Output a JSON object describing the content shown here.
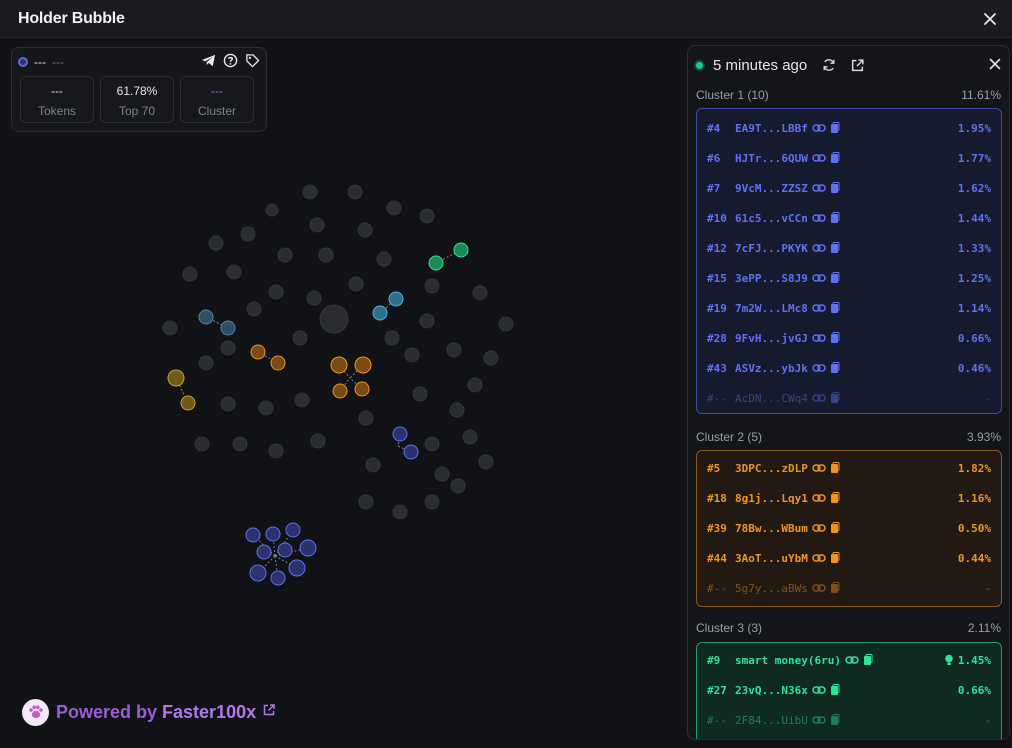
{
  "window": {
    "title": "Holder Bubble"
  },
  "token": {
    "name": "---",
    "symbol": "---"
  },
  "stats": [
    {
      "value": "---",
      "label": "Tokens"
    },
    {
      "value": "61.78%",
      "label": "Top 70"
    },
    {
      "value": "---",
      "label": "Cluster"
    }
  ],
  "powered": {
    "prefix": "Powered by",
    "brand": "Faster100x"
  },
  "panel": {
    "updated": "5 minutes ago",
    "clusters": [
      {
        "title": "Cluster 1 (10)",
        "total": "11.61%",
        "color": "#5d72ef",
        "rows": [
          {
            "rank": "#4",
            "address": "EA9T...LBBf",
            "percent": "1.95%"
          },
          {
            "rank": "#6",
            "address": "HJTr...6QUW",
            "percent": "1.77%"
          },
          {
            "rank": "#7",
            "address": "9VcM...ZZSZ",
            "percent": "1.62%"
          },
          {
            "rank": "#10",
            "address": "61c5...vCCn",
            "percent": "1.44%"
          },
          {
            "rank": "#12",
            "address": "7cFJ...PKYK",
            "percent": "1.33%"
          },
          {
            "rank": "#15",
            "address": "3ePP...S8J9",
            "percent": "1.25%"
          },
          {
            "rank": "#19",
            "address": "7m2W...LMc8",
            "percent": "1.14%"
          },
          {
            "rank": "#28",
            "address": "9FvH...jvGJ",
            "percent": "0.66%"
          },
          {
            "rank": "#43",
            "address": "ASVz...ybJk",
            "percent": "0.46%"
          },
          {
            "rank": "#--",
            "address": "AcDN...CWq4",
            "percent": "-"
          }
        ]
      },
      {
        "title": "Cluster 2 (5)",
        "total": "3.93%",
        "color": "#ee9424",
        "rows": [
          {
            "rank": "#5",
            "address": "3DPC...zDLP",
            "percent": "1.82%"
          },
          {
            "rank": "#18",
            "address": "8g1j...Lqy1",
            "percent": "1.16%"
          },
          {
            "rank": "#39",
            "address": "78Bw...WBum",
            "percent": "0.50%"
          },
          {
            "rank": "#44",
            "address": "3AoT...uYbM",
            "percent": "0.44%"
          },
          {
            "rank": "#--",
            "address": "5g7y...aBWs",
            "percent": "-"
          }
        ]
      },
      {
        "title": "Cluster 3 (3)",
        "total": "2.11%",
        "color": "#2fe39a",
        "rows": [
          {
            "rank": "#9",
            "address": "smart money(6ru)",
            "percent": "1.45%"
          },
          {
            "rank": "#27",
            "address": "23vQ...N36x",
            "percent": "0.66%"
          },
          {
            "rank": "#--",
            "address": "2F84...UibU",
            "percent": "-"
          }
        ]
      }
    ]
  },
  "colors": {
    "cluster1": "#5d72ef",
    "cluster2": "#ee9424",
    "cluster3": "#2fe39a",
    "cluster4": "#4fa3c7",
    "cluster5": "#c8a132",
    "neutral": "#2b2d33"
  }
}
